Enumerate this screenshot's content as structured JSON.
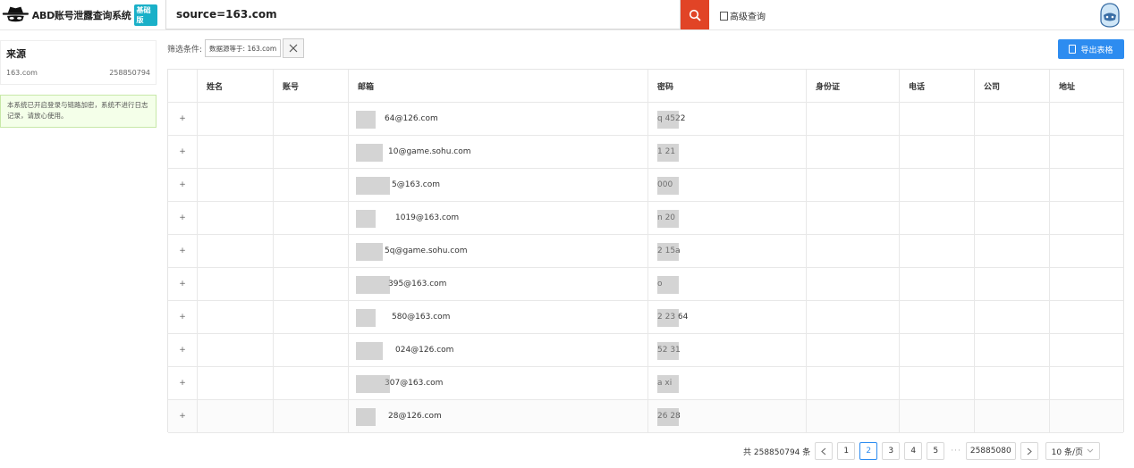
{
  "app": {
    "title": "ABD账号泄露查询系统",
    "badge": "基础版"
  },
  "search": {
    "value": "source=163.com",
    "advanced_label": "高级查询"
  },
  "sidebar": {
    "title": "来源",
    "sources": [
      {
        "name": "163.com",
        "count": "258850794"
      }
    ],
    "notice": "本系统已开启登录与链路加密，系统不进行日志记录，请放心使用。"
  },
  "filter": {
    "label": "筛选条件:",
    "tag": "数据源等于: 163.com"
  },
  "export_label": "导出表格",
  "table": {
    "headers": [
      "",
      "姓名",
      "账号",
      "邮箱",
      "密码",
      "身份证",
      "电话",
      "公司",
      "地址"
    ],
    "rows": [
      {
        "expand": "+",
        "email": "64@126.com",
        "password": "q  4522"
      },
      {
        "expand": "+",
        "email": "10@game.sohu.com",
        "password": "1  21"
      },
      {
        "expand": "+",
        "email": "5@163.com",
        "password": "000"
      },
      {
        "expand": "+",
        "email": "1019@163.com",
        "password": "n  20"
      },
      {
        "expand": "+",
        "email": "5q@game.sohu.com",
        "password": "2  15a"
      },
      {
        "expand": "+",
        "email": "395@163.com",
        "password": "o"
      },
      {
        "expand": "+",
        "email": "580@163.com",
        "password": "2  23  64"
      },
      {
        "expand": "+",
        "email": "024@126.com",
        "password": "52  31"
      },
      {
        "expand": "+",
        "email": "307@163.com",
        "password": "a  xi"
      },
      {
        "expand": "+",
        "email": "28@126.com",
        "password": "26  28"
      }
    ]
  },
  "pagination": {
    "total_text": "共 258850794 条",
    "pages": [
      "1",
      "2",
      "3",
      "4",
      "5"
    ],
    "active_page": "2",
    "ellipsis": "···",
    "last_page": "25885080",
    "page_size": "10 条/页"
  },
  "colors": {
    "search_button": "#e14426",
    "export_button": "#2d8cf0",
    "active_page": "#2d8cf0",
    "notice_bg": "#f4ffe9"
  }
}
